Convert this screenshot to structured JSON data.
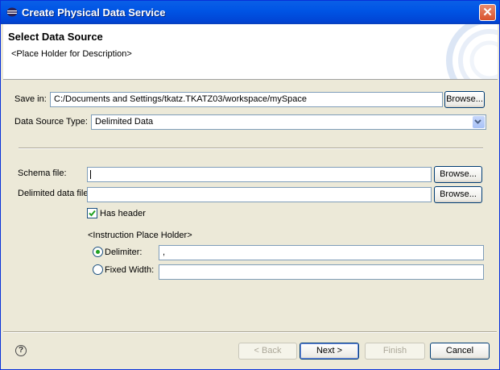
{
  "window": {
    "title": "Create Physical Data Service",
    "close_glyph": "✕"
  },
  "header": {
    "title": "Select Data Source",
    "description": "<Place Holder for Description>"
  },
  "form": {
    "save_in_label": "Save in:",
    "save_in_value": "C:/Documents and Settings/tkatz.TKATZ03/workspace/mySpace",
    "browse_label": "Browse...",
    "data_source_type_label": "Data Source Type:",
    "data_source_type_value": "Delimited Data",
    "schema_file_label": "Schema file:",
    "schema_file_value": "",
    "delimited_file_label": "Delimited data file:",
    "delimited_file_value": "",
    "has_header_label": "Has header",
    "has_header_checked": true,
    "instruction": "<Instruction Place Holder>",
    "delimiter_label": "Delimiter:",
    "delimiter_value": ",",
    "delimiter_selected": true,
    "fixed_width_label": "Fixed Width:",
    "fixed_width_value": ""
  },
  "footer": {
    "help_glyph": "?",
    "back_label": "< Back",
    "next_label": "Next >",
    "finish_label": "Finish",
    "cancel_label": "Cancel"
  },
  "icons": {
    "title": "eclipse-icon",
    "help": "help-icon",
    "check": "check-icon",
    "dropdown": "chevron-down-icon"
  }
}
